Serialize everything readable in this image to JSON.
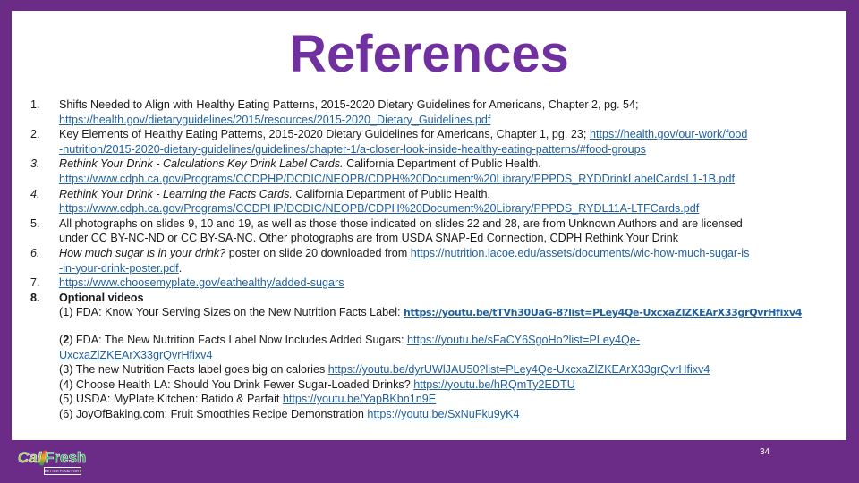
{
  "slide": {
    "title": "References",
    "page_number": "34",
    "colors": {
      "frame": "#6b2c87",
      "title": "#7030a0",
      "link": "#1f5f9e"
    }
  },
  "logo": {
    "cal": "Cal",
    "fresh": "Fresh",
    "tagline": "BETTER FOOD FOR BETTER LIVING"
  },
  "references": [
    {
      "num": "1.",
      "text": "Shifts Needed to Align with Healthy Eating Patterns, 2015-2020 Dietary Guidelines for Americans, Chapter 2, pg. 54;",
      "link": "https://health.gov/dietaryguidelines/2015/resources/2015-2020_Dietary_Guidelines.pdf"
    },
    {
      "num": "2.",
      "text": "Key Elements of Healthy Eating Patterns, 2015-2020 Dietary Guidelines for Americans, Chapter 1, pg. 23;",
      "link_part1": "https://health.gov/our-work/food",
      "link_part2": "-nutrition/2015-2020-dietary-guidelines/guidelines/chapter-1/a-closer-look-inside-healthy-eating-patterns/#food-groups"
    },
    {
      "num": "3.",
      "title_italic": "Rethink Your Drink - Calculations Key Drink Label Cards.",
      "text": "California Department of Public Health.",
      "link": "https://www.cdph.ca.gov/Programs/CCDPHP/DCDIC/NEOPB/CDPH%20Document%20Library/PPPDS_RYDDrinkLabelCardsL1-1B.pdf"
    },
    {
      "num": "4.",
      "title_italic": "Rethink Your Drink - Learning the Facts Cards.",
      "text": "California Department of Public Health.",
      "link": "https://www.cdph.ca.gov/Programs/CCDPHP/DCDIC/NEOPB/CDPH%20Document%20Library/PPPDS_RYDL11A-LTFCards.pdf"
    },
    {
      "num": "5.",
      "line1": "All photographs on slides 9, 10 and 19, as well as those those indicated on slides 22 and 28, are from Unknown Authors and are licensed",
      "line2": "under CC BY-NC-ND or CC BY-SA-NC.  Other photographs are from USDA SNAP-Ed Connection, CDPH Rethink Your Drink"
    },
    {
      "num": "6.",
      "title_italic": "How much sugar is in your drink?",
      "text": "poster on slide 20 downloaded from",
      "link_part1": "https://nutrition.lacoe.edu/assets/documents/wic-how-much-sugar-is",
      "link_part2": "-in-your-drink-poster.pdf",
      "trailing": "."
    },
    {
      "num": "7.",
      "link": "https://www.choosemyplate.gov/eathealthy/added-sugars"
    },
    {
      "num": "8.",
      "heading": "Optional videos",
      "videos": [
        {
          "label": "(1) FDA: Know Your Serving Sizes on the New Nutrition Facts Label:",
          "link": "https://youtu.be/tTVh30UaG-8?list=PLey4Qe-UxcxaZlZKEArX33grQvrHfixv4"
        },
        {
          "label_prefix": "(",
          "label_num": "2",
          "label": ") FDA: The New Nutrition Facts Label Now Includes Added Sugars:",
          "link_part1": "https://youtu.be/sFaCY6SgoHo?list=PLey4Qe-",
          "link_part2": "UxcxaZlZKEArX33grQvrHfixv4"
        },
        {
          "label": "(3) The new Nutrition Facts label goes big on calories",
          "link": "https://youtu.be/dyrUWlJAU50?list=PLey4Qe-UxcxaZlZKEArX33grQvrHfixv4"
        },
        {
          "label": "(4) Choose Health LA: Should You Drink Fewer Sugar-Loaded Drinks?",
          "link": "https://youtu.be/hRQmTy2EDTU"
        },
        {
          "label": "(5) USDA: MyPlate Kitchen: Batido & Parfait",
          "link": "https://youtu.be/YapBKbn1n9E"
        },
        {
          "label": "(6) JoyOfBaking.com: Fruit Smoothies Recipe Demonstration",
          "link": "https://youtu.be/SxNuFku9yK4"
        }
      ]
    }
  ]
}
